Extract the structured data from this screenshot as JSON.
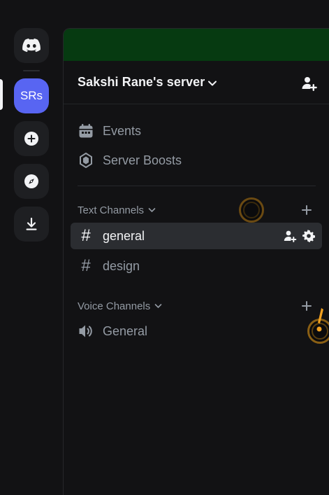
{
  "rail": {
    "home_icon": "discord-logo-icon",
    "server_initials": "SRs",
    "add_icon": "plus-circle-icon",
    "discover_icon": "compass-icon",
    "download_icon": "download-icon"
  },
  "server": {
    "name": "Sakshi Rane's server",
    "banner_color": "#063a11"
  },
  "menu": {
    "events_label": "Events",
    "boosts_label": "Server Boosts"
  },
  "categories": {
    "text": "Text Channels",
    "voice": "Voice Channels"
  },
  "channels": {
    "text": [
      {
        "name": "general",
        "active": true
      },
      {
        "name": "design",
        "active": false
      }
    ],
    "voice": [
      {
        "name": "General"
      }
    ],
    "hash_symbol": "#"
  },
  "colors": {
    "accent": "#5865f2",
    "background": "#121214",
    "muted_text": "#949ba4",
    "bright_text": "#f2f3f5"
  }
}
